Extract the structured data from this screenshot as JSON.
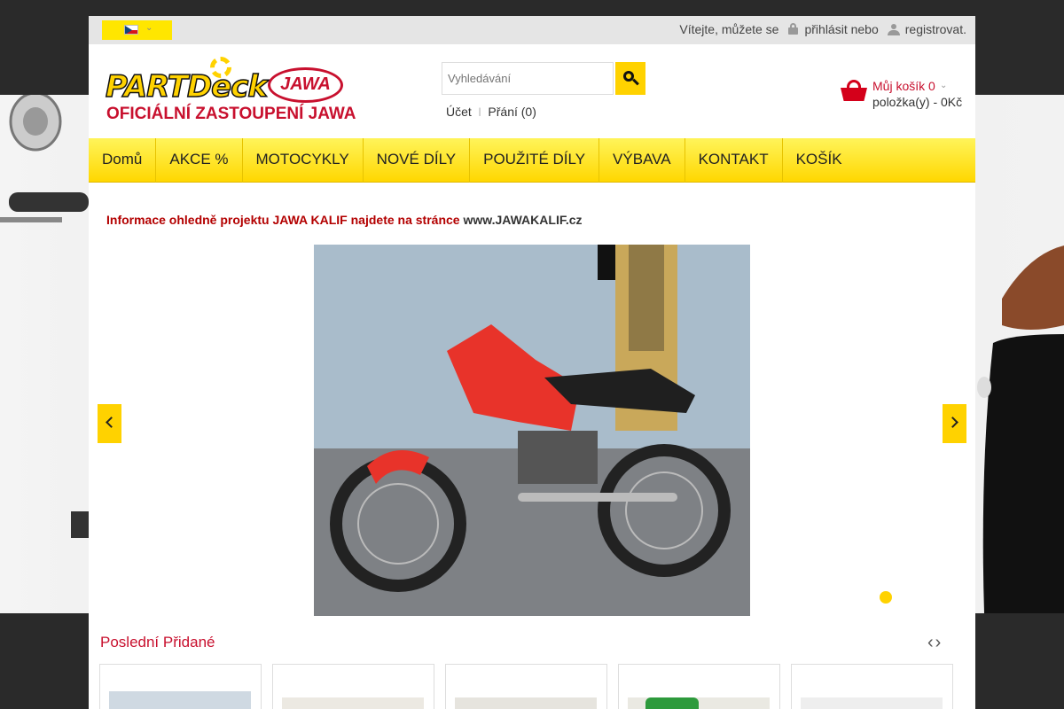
{
  "topbar": {
    "welcome": "Vítejte, můžete se",
    "login": "přihlásit nebo",
    "register": "registrovat."
  },
  "logo": {
    "brand": "PARTDeck",
    "jawa": "JAWA",
    "tagline": "OFICIÁLNÍ ZASTOUPENÍ JAWA"
  },
  "search": {
    "placeholder": "Vyhledávání"
  },
  "account": {
    "account": "Účet",
    "wishlist": "Přání (0)"
  },
  "cart": {
    "title": "Můj košík",
    "count": "0",
    "info": "položka(y) - 0Kč"
  },
  "nav": {
    "items": [
      {
        "label": "Domů"
      },
      {
        "label": "AKCE %"
      },
      {
        "label": "MOTOCYKLY"
      },
      {
        "label": "NOVÉ DÍLY"
      },
      {
        "label": "POUŽITÉ DÍLY"
      },
      {
        "label": "VÝBAVA"
      },
      {
        "label": "KONTAKT"
      },
      {
        "label": "KOŠÍK"
      }
    ]
  },
  "notice": {
    "text": "Informace ohledně projektu JAWA KALIF najdete na stránce",
    "link": "www.JAWAKALIF.cz"
  },
  "slider": {
    "image_label": "JAWA"
  },
  "latest": {
    "title": "Poslední Přidané",
    "nav": "‹›"
  },
  "colors": {
    "accent": "#ffd200",
    "brand_red": "#c8102e"
  }
}
